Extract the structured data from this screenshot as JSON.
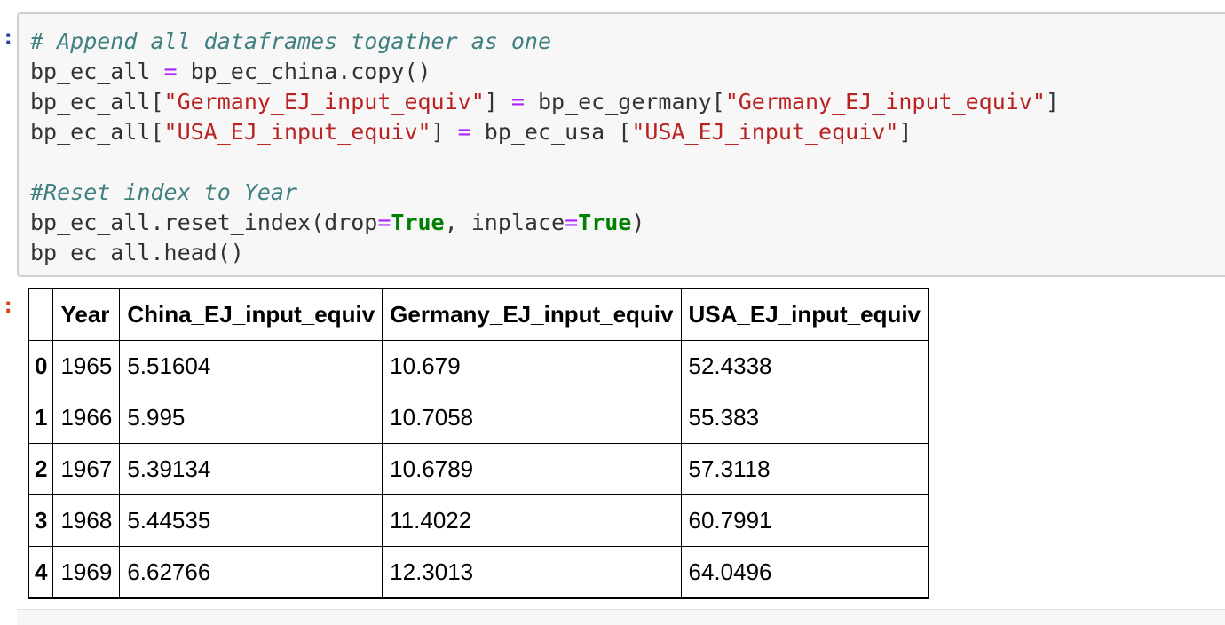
{
  "cell": {
    "input_prompt": ":",
    "output_prompt": ":"
  },
  "code": {
    "comment1": "# Append all dataframes togather as one",
    "line2": {
      "lhs": "bp_ec_all",
      "eq": " = ",
      "rhs": "bp_ec_china.copy()"
    },
    "line3": {
      "lhs": "bp_ec_all[",
      "key1": "\"Germany_EJ_input_equiv\"",
      "mid": "] ",
      "eq": "=",
      "rhs": " bp_ec_germany[",
      "key2": "\"Germany_EJ_input_equiv\"",
      "end": "]"
    },
    "line4": {
      "lhs": "bp_ec_all[",
      "key1": "\"USA_EJ_input_equiv\"",
      "mid": "] ",
      "eq": "=",
      "rhs": " bp_ec_usa [",
      "key2": "\"USA_EJ_input_equiv\"",
      "end": "]"
    },
    "comment2": "#Reset index to Year",
    "line7": {
      "pre": "bp_ec_all.reset_index(drop",
      "eq1": "=",
      "kw1": "True",
      "mid": ", inplace",
      "eq2": "=",
      "kw2": "True",
      "end": ")"
    },
    "line8": "bp_ec_all.head()"
  },
  "table": {
    "columns": [
      "",
      "Year",
      "China_EJ_input_equiv",
      "Germany_EJ_input_equiv",
      "USA_EJ_input_equiv"
    ],
    "rows": [
      {
        "index": "0",
        "year": "1965",
        "china": "5.51604",
        "germany": "10.679",
        "usa": "52.4338"
      },
      {
        "index": "1",
        "year": "1966",
        "china": "5.995",
        "germany": "10.7058",
        "usa": "55.383"
      },
      {
        "index": "2",
        "year": "1967",
        "china": "5.39134",
        "germany": "10.6789",
        "usa": "57.3118"
      },
      {
        "index": "3",
        "year": "1968",
        "china": "5.44535",
        "germany": "11.4022",
        "usa": "60.7991"
      },
      {
        "index": "4",
        "year": "1969",
        "china": "6.62766",
        "germany": "12.3013",
        "usa": "64.0496"
      }
    ]
  }
}
